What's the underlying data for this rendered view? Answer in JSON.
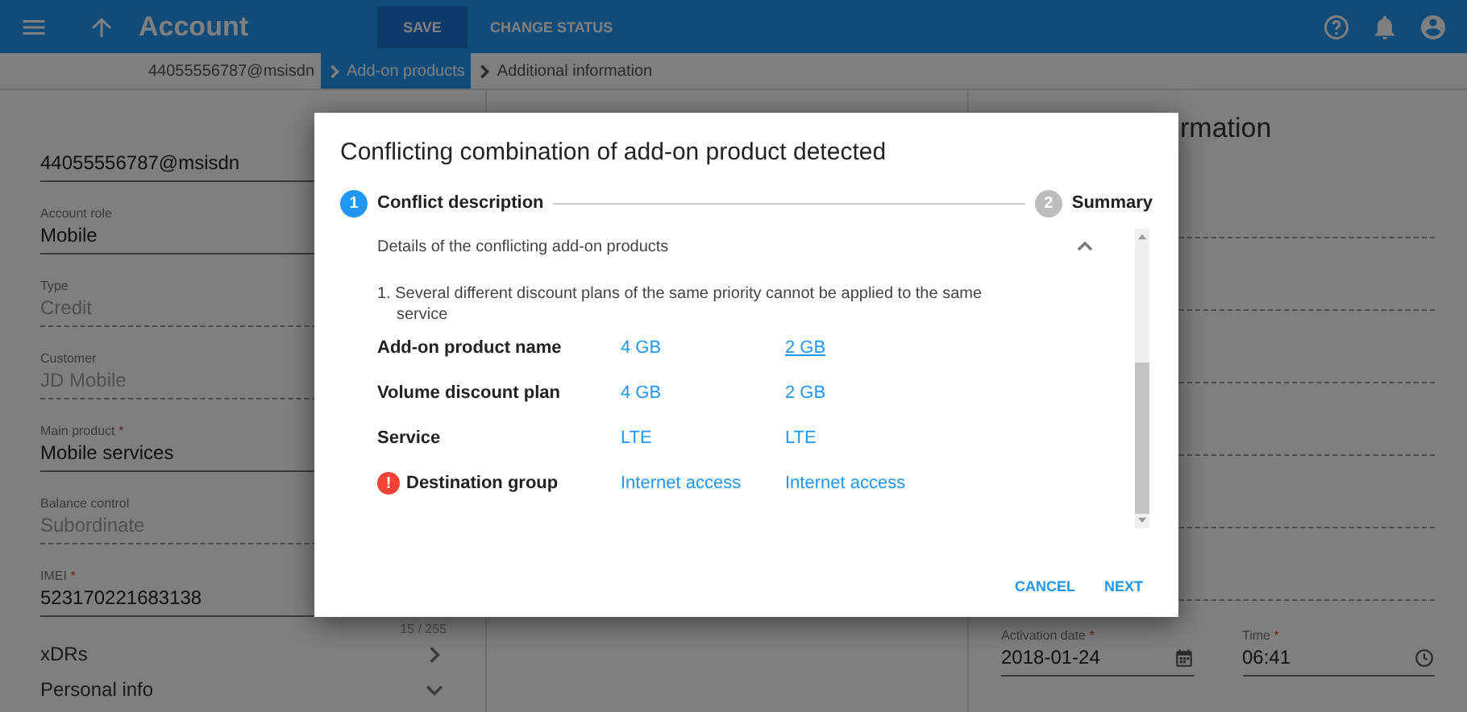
{
  "top_bar": {
    "title": "Account",
    "buttons": [
      {
        "label": "SAVE",
        "kind": "filled"
      },
      {
        "label": "CHANGE STATUS",
        "kind": "text"
      }
    ]
  },
  "breadcrumbs": [
    {
      "label": "44055556787@msisdn",
      "selected": false
    },
    {
      "label": "Add-on products",
      "selected": true
    },
    {
      "label": "Additional information",
      "selected": false
    }
  ],
  "left_panel": {
    "fields": [
      {
        "value": "44055556787@msisdn",
        "disabled": false,
        "required": false
      },
      {
        "label": "Account role",
        "value": "Mobile",
        "disabled": false,
        "required": false
      },
      {
        "label": "Type",
        "value": "Credit",
        "disabled": true,
        "required": false
      },
      {
        "label": "Customer",
        "value": "JD Mobile",
        "disabled": true,
        "required": false
      },
      {
        "label": "Main product",
        "value": "Mobile services",
        "disabled": false,
        "required": true
      },
      {
        "label": "Balance control",
        "value": "Subordinate",
        "disabled": true,
        "required": false
      },
      {
        "label": "IMEI",
        "value": "523170221683138",
        "disabled": false,
        "required": true,
        "counter": "15 / 255"
      }
    ],
    "required_mark": "*",
    "sections": [
      {
        "label": "xDRs",
        "expanded": false
      },
      {
        "label": "Personal info",
        "expanded": true
      }
    ]
  },
  "right_panel": {
    "heading": "rmation",
    "activation_date": {
      "label": "Activation date",
      "value": "2018-01-24"
    },
    "time": {
      "label": "Time",
      "value": "06:41"
    }
  },
  "dialog": {
    "title": "Conflicting combination of add-on product detected",
    "steps": [
      {
        "number": "1",
        "label": "Conflict description",
        "selected": true
      },
      {
        "number": "2",
        "label": "Summary",
        "selected": false
      }
    ],
    "section": {
      "title": "Details of the conflicting add-on products",
      "expanded": true
    },
    "message": "1. Several different discount plans of the same priority cannot be applied to the same service",
    "rows": [
      {
        "label": "Add-on product name",
        "error": false,
        "values": [
          {
            "text": "4 GB",
            "underlined": false
          },
          {
            "text": "2 GB",
            "underlined": true
          }
        ]
      },
      {
        "label": "Volume discount plan",
        "error": false,
        "values": [
          {
            "text": "4 GB",
            "underlined": false
          },
          {
            "text": "2 GB",
            "underlined": false
          }
        ]
      },
      {
        "label": "Service",
        "error": false,
        "values": [
          {
            "text": "LTE",
            "underlined": false
          },
          {
            "text": "LTE",
            "underlined": false
          }
        ]
      },
      {
        "label": "Destination group",
        "error": true,
        "values": [
          {
            "text": "Internet access",
            "underlined": false
          },
          {
            "text": "Internet access",
            "underlined": false
          }
        ]
      }
    ],
    "error_mark": "!",
    "buttons": [
      "CANCEL",
      "NEXT"
    ]
  }
}
